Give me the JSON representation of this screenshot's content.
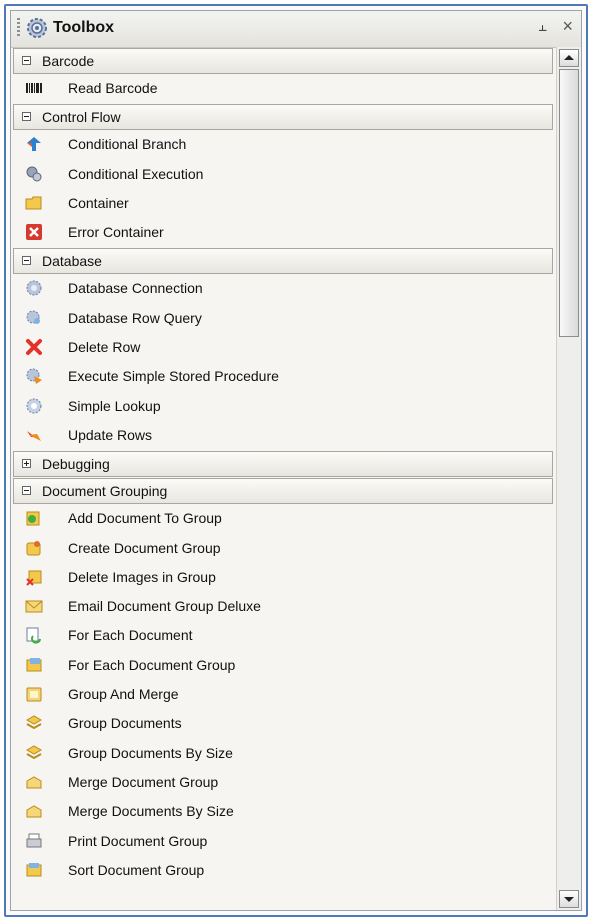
{
  "panel": {
    "title": "Toolbox",
    "pin_glyph": "⫠",
    "close_glyph": "×"
  },
  "groups": [
    {
      "label": "Barcode",
      "expanded": true,
      "items": [
        {
          "label": "Read Barcode",
          "icon": "barcode-icon"
        }
      ]
    },
    {
      "label": "Control Flow",
      "expanded": true,
      "items": [
        {
          "label": "Conditional Branch",
          "icon": "branch-arrows-icon"
        },
        {
          "label": "Conditional Execution",
          "icon": "gears-icon"
        },
        {
          "label": "Container",
          "icon": "folder-icon"
        },
        {
          "label": "Error Container",
          "icon": "error-box-icon"
        }
      ]
    },
    {
      "label": "Database",
      "expanded": true,
      "items": [
        {
          "label": "Database Connection",
          "icon": "database-gear-icon"
        },
        {
          "label": "Database Row Query",
          "icon": "database-query-icon"
        },
        {
          "label": "Delete Row",
          "icon": "red-x-icon"
        },
        {
          "label": "Execute Simple Stored Procedure",
          "icon": "database-execute-icon"
        },
        {
          "label": "Simple Lookup",
          "icon": "database-lookup-icon"
        },
        {
          "label": "Update Rows",
          "icon": "update-rows-icon"
        }
      ]
    },
    {
      "label": "Debugging",
      "expanded": false,
      "items": []
    },
    {
      "label": "Document Grouping",
      "expanded": true,
      "items": [
        {
          "label": "Add Document To Group",
          "icon": "add-document-group-icon"
        },
        {
          "label": "Create Document Group",
          "icon": "create-group-icon"
        },
        {
          "label": "Delete Images in Group",
          "icon": "delete-images-icon"
        },
        {
          "label": "Email Document Group Deluxe",
          "icon": "envelope-icon"
        },
        {
          "label": "For Each Document",
          "icon": "for-each-document-icon"
        },
        {
          "label": "For Each Document Group",
          "icon": "for-each-group-icon"
        },
        {
          "label": "Group And Merge",
          "icon": "group-merge-icon"
        },
        {
          "label": "Group Documents",
          "icon": "group-documents-icon"
        },
        {
          "label": "Group Documents By Size",
          "icon": "group-by-size-icon"
        },
        {
          "label": "Merge Document Group",
          "icon": "merge-group-icon"
        },
        {
          "label": "Merge Documents By Size",
          "icon": "merge-by-size-icon"
        },
        {
          "label": "Print Document Group",
          "icon": "printer-icon"
        },
        {
          "label": "Sort Document Group",
          "icon": "sort-group-icon"
        }
      ]
    }
  ],
  "colors": {
    "frame": "#4f79b8",
    "background": "#f6f5f1"
  }
}
